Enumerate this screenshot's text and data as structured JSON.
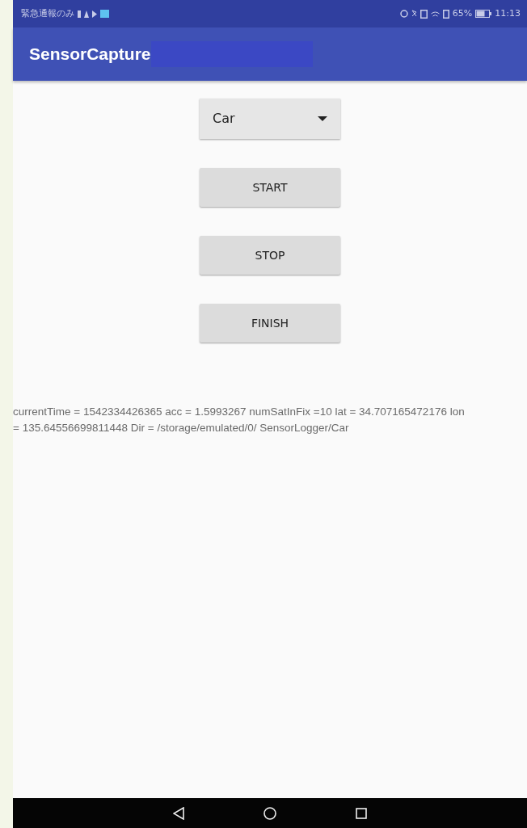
{
  "status_bar": {
    "carrier": "緊急通報のみ",
    "battery": "65%",
    "time": "11:13"
  },
  "app_bar": {
    "title": "SensorCapture"
  },
  "spinner": {
    "value": "Car"
  },
  "buttons": [
    "START",
    "STOP",
    "FINISH"
  ],
  "log_text": "currentTime = 1542334426365 acc = 1.5993267 numSatInFix =10 lat = 34.707165472176 lon = 135.64556699811448 Dir = /storage/emulated/0/ SensorLogger/Car"
}
